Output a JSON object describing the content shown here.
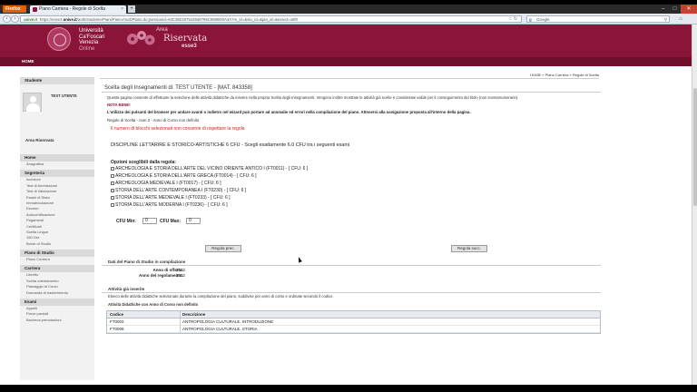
{
  "browser": {
    "app_label": "Firefox",
    "tab_title": "Piano Carriera - Regole di Scelta",
    "tab_close": "×",
    "new_tab": "+",
    "url_site": "unive.it",
    "url_prefix": "https://esse3.",
    "url_host_bold": "unive.it",
    "url_path": "/auth/studente/Piani/PianoAnoDPiano.do;jsessionid=63C382187542946796C8808D0A4A?m_id=&stu_id=&pia_id=&esse3=x6f0",
    "search_engine": "Google",
    "search_placeholder": "Google",
    "window_controls": [
      "–",
      "□",
      "✕"
    ]
  },
  "header": {
    "university_lines": [
      "Università",
      "Ca'Foscari",
      "Venezia",
      "Online"
    ],
    "area_label": "Area",
    "area_big": "Riservata",
    "area_small": "esse3",
    "home": "HOME"
  },
  "breadcrumb": "HOME » Piano Carriera » Regole di Scelta",
  "sidebar": {
    "student_header": "Studente",
    "user_name": "TEST UTENTE",
    "area_riservata": "Area Riservata",
    "sections": [
      {
        "title": "Home",
        "items": [
          "Anagrafica"
        ]
      },
      {
        "title": "Segreteria",
        "items": [
          "Iscrizioni",
          "Test di Ammissione",
          "Test di Valutazione",
          "Esami di Stato",
          "Immatricolazione",
          "Esoneri",
          "Autocertificazione",
          "Pagamenti",
          "Certificati",
          "Scelta Lingue",
          "150 Ore",
          "Borse di Studio"
        ]
      },
      {
        "title": "Piano di Studio",
        "items": [
          "Piano Carriera"
        ]
      },
      {
        "title": "Carriera",
        "items": [
          "Libretto",
          "Scelta orientamento",
          "Passaggio di Corso",
          "Domanda di trasferimento"
        ]
      },
      {
        "title": "Esami",
        "items": [
          "Appelli",
          "Prove parziali",
          "Bacheca prenotazioni"
        ]
      }
    ]
  },
  "main": {
    "title": "Scelta degli Insegnamenti di: TEST UTENTE - [MAT. 843358]",
    "description": "Questa pagina consente di effettuare la selezione delle attività didattiche da inserire nella propria Scelta degli Insegnamenti. Vengono inoltre mostrate le attività già scelte e considerate valide per il conseguimento del titolo (non sovrannumerarie).",
    "nota_bene": "NOTA BENE!",
    "warning": "L'utilizzo dei pulsanti del browser per andare avanti o indietro nel wizard può portare ad anomalie ed errori nella compilazione del piano. Attenersi alla navigazione proposta all'interno della pagina.",
    "regole": "Regole di Scelta - num.3 - Anno di Corso non definito",
    "error": "Il numero di blocchi selezionati non consente di rispettare la regola",
    "discipline": "DISCIPLINE LETTARIRE E STORICO-ARTISTICHE 6 CFU - Scegli esattamente 6.0 CFU tra i seguenti esami",
    "options_title": "Opzioni sceglibili dalla regola:",
    "options": [
      "ARCHEOLOGIA E STORIA DELL'ARTE DEL VICINO ORIENTE ANTICO I (FT0011) - [ CFU: 6 ]",
      "ARCHEOLOGIA E STORIA DELL'ARTE GRECA (FT0014) - [ CFU: 6 ]",
      "ARCHEOLOGIA MEDIEVALE I (FT0017) - [ CFU: 6 ]",
      "STORIA DELL'ARTE CONTEMPORANEA I (FT0230) - [ CFU: 6 ]",
      "STORIA DELL'ARTE MEDIEVALE I (FT0233) - [ CFU: 6 ]",
      "STORIA DELL'ARTE MODERNA I (FT0236) - [ CFU: 6 ]"
    ],
    "cfu_min_label": "CFU Min:",
    "cfu_min_value": "0",
    "cfu_max_label": "CFU Max:",
    "cfu_max_value": "0",
    "btn_prev": "Regola prec.",
    "btn_next": "Regola succ.",
    "piano_title": "Dati del Piano di Studio in compilazione",
    "anno_offerta_label": "Anno di offerta:",
    "anno_offerta_value": "2012",
    "anno_regolamento_label": "Anno del regolamento:",
    "anno_regolamento_value": "2012",
    "attivita_title": "Attività già inserite",
    "attivita_desc": "Elenco delle attività didattiche selezionate durante la compilazione del piano, suddivise per anno di corso e ordinate secondo il codice.",
    "attivita_sub": "Attività Didattiche con Anno di Corso non definito",
    "table_headers": [
      "Codice",
      "Descrizione"
    ],
    "table_rows": [
      [
        "FT0003",
        "ANTROPOLOGIA CULTURALE. INTRODUZIONE"
      ],
      [
        "FT0006",
        "ANTROPOLOGIA CULTURALE. STORIA"
      ]
    ]
  }
}
